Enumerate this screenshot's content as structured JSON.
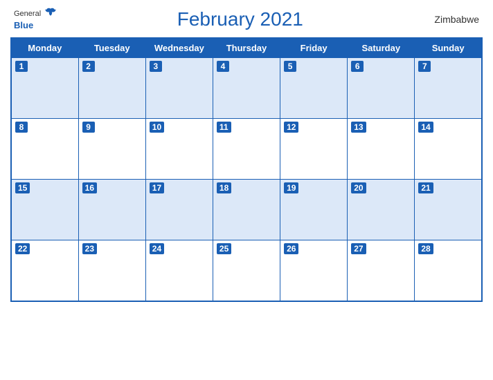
{
  "header": {
    "logo_general": "General",
    "logo_blue": "Blue",
    "title": "February 2021",
    "country": "Zimbabwe"
  },
  "weekdays": [
    "Monday",
    "Tuesday",
    "Wednesday",
    "Thursday",
    "Friday",
    "Saturday",
    "Sunday"
  ],
  "weeks": [
    [
      1,
      2,
      3,
      4,
      5,
      6,
      7
    ],
    [
      8,
      9,
      10,
      11,
      12,
      13,
      14
    ],
    [
      15,
      16,
      17,
      18,
      19,
      20,
      21
    ],
    [
      22,
      23,
      24,
      25,
      26,
      27,
      28
    ]
  ],
  "colors": {
    "blue": "#1a5fb4",
    "row_bg": "#dce8f8"
  }
}
